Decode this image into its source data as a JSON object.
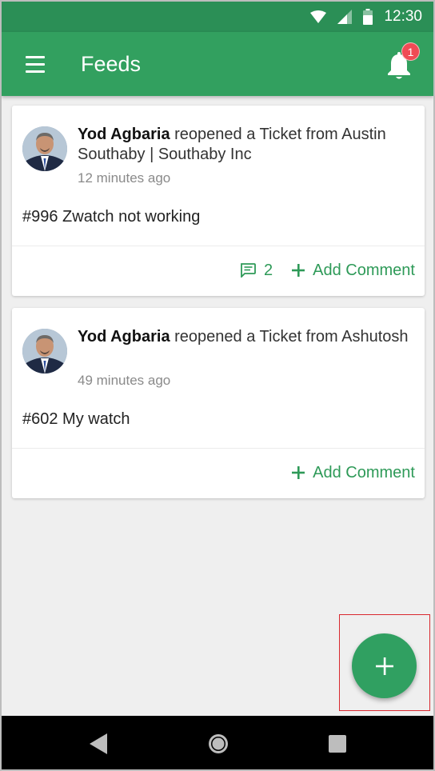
{
  "status_bar": {
    "time": "12:30",
    "icons": [
      "wifi-icon",
      "signal-icon",
      "battery-icon"
    ]
  },
  "app_bar": {
    "title": "Feeds",
    "menu_icon": "menu-icon",
    "notification_icon": "bell-icon",
    "notification_count": "1"
  },
  "feeds": [
    {
      "actor": "Yod Agbaria",
      "action": " reopened a Ticket from Austin Southaby | Southaby Inc",
      "time": "12 minutes ago",
      "ticket": "#996 Zwatch not working",
      "comment_count": "2",
      "add_comment_label": "Add Comment"
    },
    {
      "actor": "Yod Agbaria",
      "action": " reopened a Ticket from Ashutosh",
      "time": "49 minutes ago",
      "ticket": "#602 My watch",
      "add_comment_label": "Add Comment"
    }
  ],
  "fab": {
    "icon": "plus-icon"
  },
  "nav_bar": {
    "icons": [
      "back-icon",
      "home-icon",
      "recents-icon"
    ]
  },
  "colors": {
    "status_bar": "#2b8f56",
    "app_bar": "#32a05f",
    "accent": "#2e9a58",
    "badge": "#f04a55",
    "highlight_box": "#d9282f"
  }
}
